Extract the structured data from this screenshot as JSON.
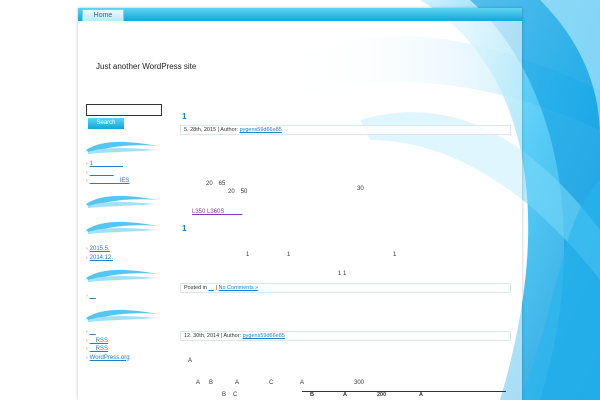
{
  "nav": {
    "home_label": "Home"
  },
  "header": {
    "tagline": "Just another WordPress site"
  },
  "sidebar": {
    "search_placeholder": "",
    "search_button": "Search",
    "recent_posts": [
      {
        "bullet": "›",
        "label": "1　　　　　"
      },
      {
        "bullet": "›",
        "label": "　　　　"
      },
      {
        "bullet": "›",
        "label": "　　　　　IES"
      }
    ],
    "archives": [
      {
        "bullet": "›",
        "label": "2015.5."
      },
      {
        "bullet": "›",
        "label": "2014.12."
      }
    ],
    "categories": [
      {
        "bullet": "›",
        "label": "　"
      }
    ],
    "meta_links": [
      {
        "bullet": "›",
        "label": "　"
      },
      {
        "bullet": "›",
        "label": "　RSS"
      },
      {
        "bullet": "›",
        "label": "　RSS"
      },
      {
        "bullet": "›",
        "label": "WordPress.org"
      }
    ]
  },
  "posts": [
    {
      "title": "1",
      "date_prefix": "5. 28th, 2015 | Author: ",
      "author": "pygens59d66e85",
      "lines": [
        "20　65",
        "20　50",
        "30"
      ],
      "link": "L350 L360S　　　",
      "title2": "1",
      "body_numbers": [
        "1",
        "1",
        "1"
      ],
      "pair": "1 1",
      "footer_prefix": "Posted in ",
      "footer_cat": "　",
      "footer_sep": " | ",
      "footer_comments": "No Comments »"
    },
    {
      "date_prefix": "12. 30th, 2014 | Author: ",
      "author": "pygens59d66e85",
      "letter": "A",
      "row1": [
        "A",
        "B",
        "A",
        "C",
        "A",
        "300"
      ],
      "row2": [
        "B",
        "C"
      ],
      "table_head": [
        "B",
        "A",
        "200",
        "A"
      ]
    }
  ]
}
